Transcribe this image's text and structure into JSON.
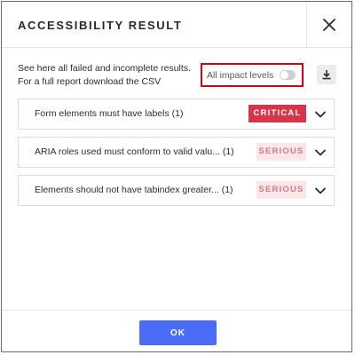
{
  "dialog": {
    "title": "ACCESSIBILITY RESULT",
    "intro_line1": "See here all failed and incomplete results.",
    "intro_line2": "For a full report download the CSV",
    "impact_toggle": {
      "label": "All impact levels",
      "checked": false
    },
    "icons": {
      "close": "close-icon",
      "download": "download-icon",
      "expand": "chevron-down-icon"
    },
    "issues": [
      {
        "text": "Form elements must have labels (1)",
        "severity": "CRITICAL"
      },
      {
        "text": "ARIA roles used must conform to valid valu... (1)",
        "severity": "SERIOUS"
      },
      {
        "text": "Elements should not have tabindex greater... (1)",
        "severity": "SERIOUS"
      }
    ],
    "ok_label": "OK",
    "colors": {
      "accent": "#4a6cf7",
      "critical": "#d6354a",
      "serious_bg": "#fbe7ea",
      "serious_text": "#d47786",
      "highlight_border": "#d0021b"
    }
  }
}
